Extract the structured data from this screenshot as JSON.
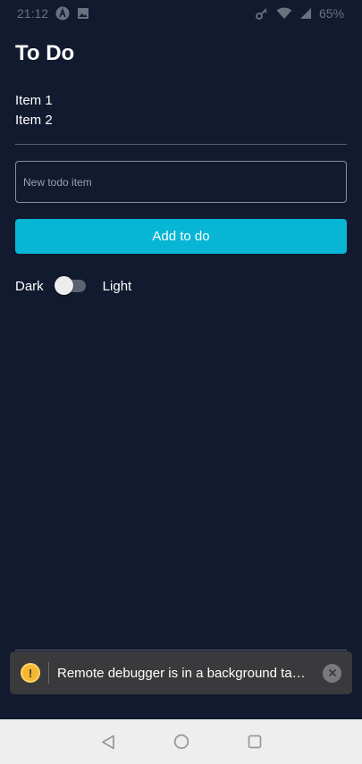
{
  "status_bar": {
    "time": "21:12",
    "battery": "65%",
    "icons": [
      "autofill-a-icon",
      "image-icon",
      "vpn-key-icon",
      "wifi-icon",
      "cell-signal-icon"
    ]
  },
  "page": {
    "title": "To Do",
    "items": [
      "Item 1",
      "Item 2"
    ]
  },
  "input": {
    "placeholder": "New todo item",
    "value": ""
  },
  "add_button": {
    "label": "Add to do"
  },
  "theme_toggle": {
    "left_label": "Dark",
    "right_label": "Light",
    "state": "dark"
  },
  "snackbar": {
    "message": "Remote debugger is in a background tab ...",
    "icon": "warning-icon",
    "accent_color": "#f5b731"
  },
  "nav_bar": {
    "buttons": [
      "back-icon",
      "home-icon",
      "recents-icon"
    ]
  },
  "colors": {
    "background": "#111a2e",
    "accent": "#06b6d4"
  }
}
